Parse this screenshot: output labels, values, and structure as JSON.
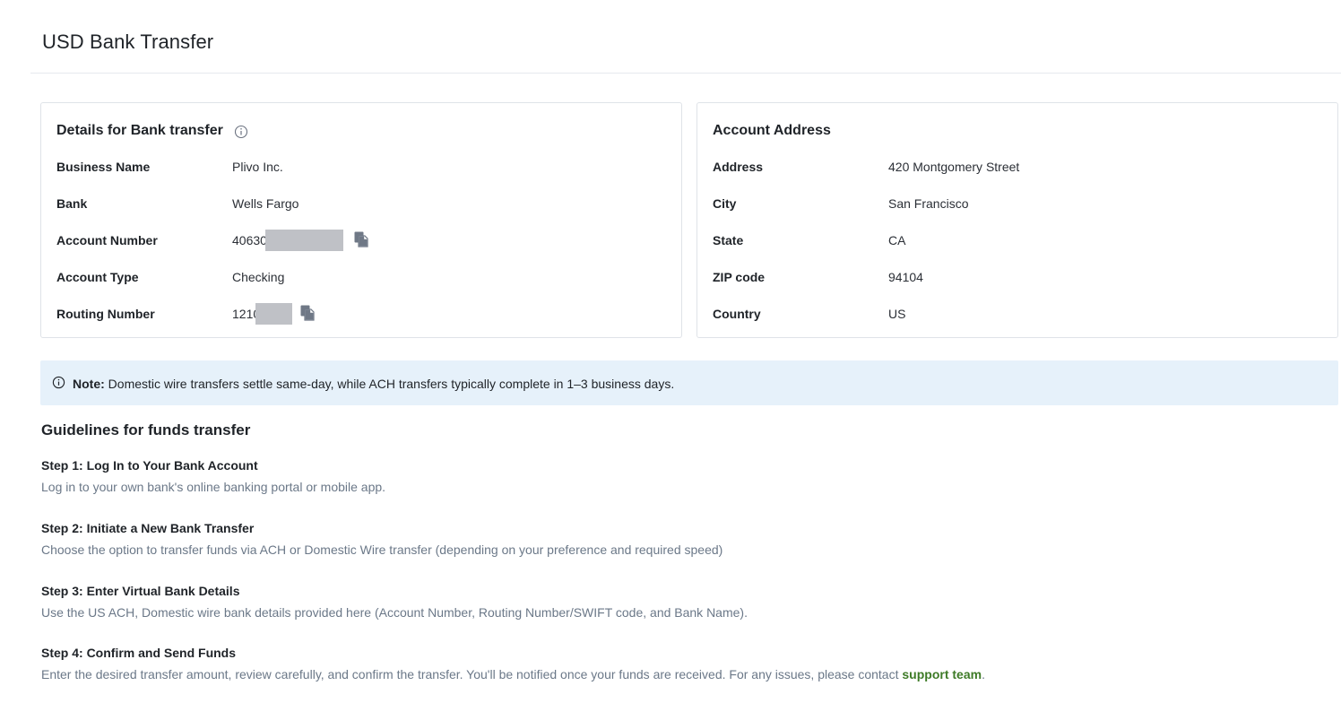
{
  "page": {
    "title": "USD Bank Transfer"
  },
  "details": {
    "title": "Details for Bank transfer",
    "info_icon": "info-icon",
    "rows": [
      {
        "label": "Business Name",
        "value": "Plivo Inc."
      },
      {
        "label": "Bank",
        "value": "Wells Fargo"
      },
      {
        "label": "Account Number",
        "value": "40630",
        "redacted": true,
        "copy_icon": "copy-icon"
      },
      {
        "label": "Account Type",
        "value": "Checking"
      },
      {
        "label": "Routing Number",
        "value": "1210",
        "redacted": true,
        "copy_icon": "copy-icon"
      }
    ]
  },
  "address": {
    "title": "Account Address",
    "rows": [
      {
        "label": "Address",
        "value": "420 Montgomery Street"
      },
      {
        "label": "City",
        "value": "San Francisco"
      },
      {
        "label": "State",
        "value": "CA"
      },
      {
        "label": "ZIP code",
        "value": "94104"
      },
      {
        "label": "Country",
        "value": "US"
      }
    ]
  },
  "note": {
    "icon": "info-icon",
    "label": "Note:",
    "text": " Domestic wire transfers settle same-day, while ACH transfers typically complete in 1–3 business days."
  },
  "guidelines": {
    "title": "Guidelines for funds transfer",
    "steps": [
      {
        "title": "Step 1: Log In to Your Bank Account",
        "desc": "Log in to your own bank's online banking portal or mobile app."
      },
      {
        "title": "Step 2: Initiate a New Bank Transfer",
        "desc": "Choose the option to transfer funds via ACH or Domestic Wire transfer (depending on your preference and required speed)"
      },
      {
        "title": "Step 3: Enter Virtual Bank Details",
        "desc": "Use the US ACH, Domestic wire bank details provided here (Account Number, Routing Number/SWIFT code, and Bank Name)."
      },
      {
        "title": "Step 4: Confirm and Send Funds",
        "desc": "Enter the desired transfer amount, review carefully, and confirm the transfer. You'll be notified once your funds are received. For any issues, please contact ",
        "link_text": "support team",
        "desc_suffix": "."
      }
    ]
  },
  "colors": {
    "note_bg": "#e6f1fa",
    "link": "#3e7b27",
    "muted_text": "#6b7888",
    "redaction": "#bfc1c6"
  }
}
